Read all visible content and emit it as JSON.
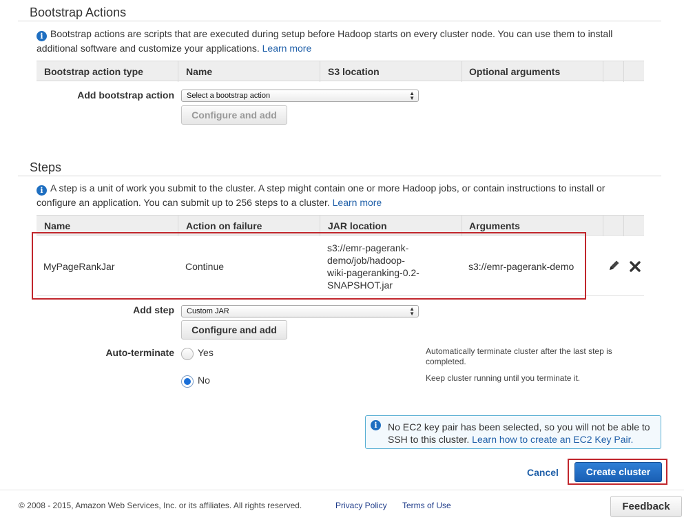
{
  "bootstrap": {
    "title": "Bootstrap Actions",
    "description": "Bootstrap actions are scripts that are executed during setup before Hadoop starts on every cluster node. You can use them to install additional software and customize your applications.",
    "learn_more": "Learn more",
    "columns": [
      "Bootstrap action type",
      "Name",
      "S3 location",
      "Optional arguments"
    ],
    "add_label": "Add bootstrap action",
    "select_value": "Select a bootstrap action",
    "configure_button": "Configure and add"
  },
  "steps": {
    "title": "Steps",
    "description": "A step is a unit of work you submit to the cluster. A step might contain one or more Hadoop jobs, or contain instructions to install or configure an application. You can submit up to 256 steps to a cluster.",
    "learn_more": "Learn more",
    "columns": [
      "Name",
      "Action on failure",
      "JAR location",
      "Arguments"
    ],
    "rows": [
      {
        "name": "MyPageRankJar",
        "action_on_failure": "Continue",
        "jar_location": "s3://emr-pagerank-demo/job/hadoop-wiki-pageranking-0.2-SNAPSHOT.jar",
        "arguments": "s3://emr-pagerank-demo"
      }
    ],
    "add_step_label": "Add step",
    "add_step_select": "Custom JAR",
    "configure_button": "Configure and add",
    "auto_terminate_label": "Auto-terminate",
    "yes_label": "Yes",
    "no_label": "No",
    "yes_help": "Automatically terminate cluster after the last step is completed.",
    "no_help": "Keep cluster running until you terminate it.",
    "auto_terminate_value": "No"
  },
  "key_pair_notice": {
    "text": "No EC2 key pair has been selected, so you will not be able to SSH to this cluster.",
    "link": "Learn how to create an EC2 Key Pair."
  },
  "actions": {
    "cancel": "Cancel",
    "create": "Create cluster"
  },
  "footer": {
    "copyright": "© 2008 - 2015, Amazon Web Services, Inc. or its affiliates. All rights reserved.",
    "privacy": "Privacy Policy",
    "terms": "Terms of Use",
    "feedback": "Feedback"
  },
  "colors": {
    "accent": "#1f6fc1",
    "highlight": "#c1262c",
    "primary_button": "#1a5fb4"
  },
  "icons": [
    "info-icon",
    "pencil-icon",
    "delete-x-icon",
    "select-arrows-icon"
  ]
}
